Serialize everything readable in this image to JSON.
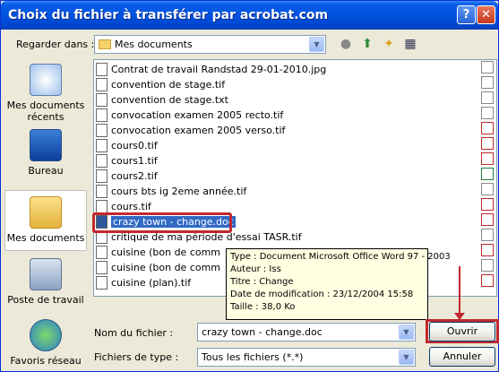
{
  "window": {
    "title": "Choix du fichier à transférer par acrobat.com",
    "help": "?",
    "close": "✕"
  },
  "lookin": {
    "label": "Regarder dans :",
    "value": "Mes documents"
  },
  "places": [
    {
      "label": "Mes documents récents",
      "icon": "recent-documents-icon"
    },
    {
      "label": "Bureau",
      "icon": "desktop-icon"
    },
    {
      "label": "Mes documents",
      "icon": "my-documents-icon"
    },
    {
      "label": "Poste de travail",
      "icon": "my-computer-icon"
    },
    {
      "label": "Favoris réseau",
      "icon": "network-places-icon"
    }
  ],
  "files": [
    "Contrat de travail Randstad 29-01-2010.jpg",
    "convention de stage.tif",
    "convention de stage.txt",
    "convocation examen 2005 recto.tif",
    "convocation examen 2005 verso.tif",
    "cours0.tif",
    "cours1.tif",
    "cours2.tif",
    "cours bts ig 2eme année.tif",
    "cours.tif",
    "crazy town - change.doc",
    "critique de ma période d'essai TASR.tif",
    "cuisine (bon de comm",
    "cuisine (bon de comm",
    "cuisine (plan).tif"
  ],
  "tooltip": {
    "type": "Type : Document Microsoft Office Word 97 - 2003",
    "author": "Auteur : Iss",
    "title": "Titre : Change",
    "modified": "Date de modification : 23/12/2004 15:58",
    "size": "Taille  : 38,0 Ko"
  },
  "filename": {
    "label": "Nom du fichier :",
    "value": "crazy town - change.doc"
  },
  "filetype": {
    "label": "Fichiers de type :",
    "value": "Tous les fichiers (*.*)"
  },
  "buttons": {
    "open": "Ouvrir",
    "cancel": "Annuler"
  },
  "colors": {
    "titlebar": "#0054e3",
    "highlight": "#c0282d",
    "selection": "#316ac5"
  }
}
